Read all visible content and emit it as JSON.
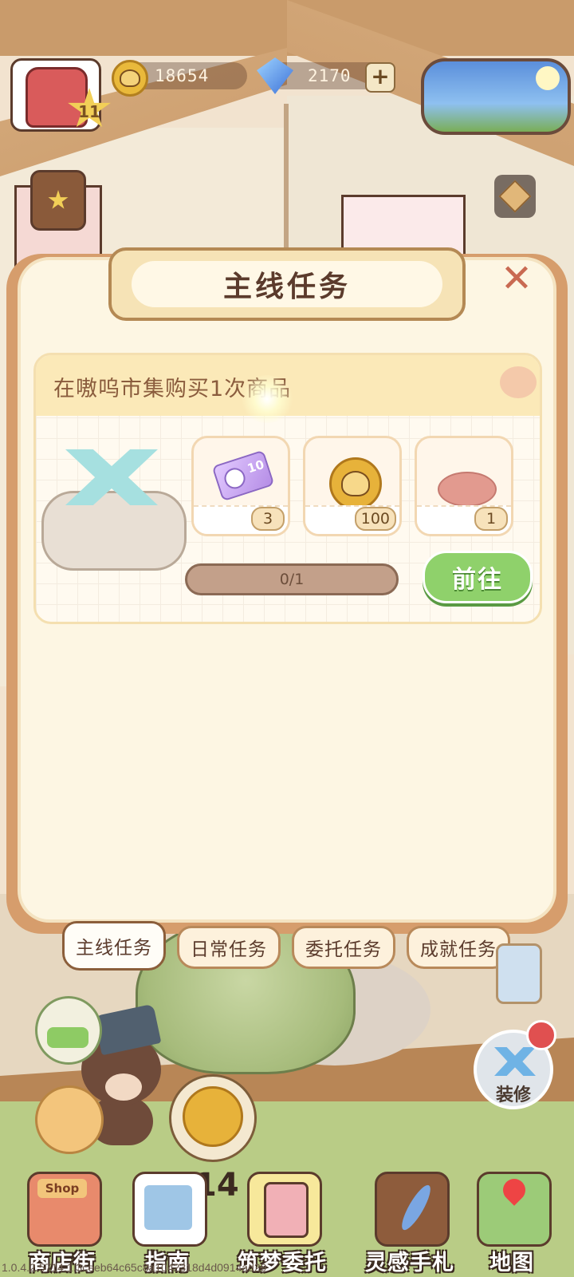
{
  "top_bar": {
    "level": "11",
    "coins": "18654",
    "gems": "2170",
    "plus_label": "+"
  },
  "dialog": {
    "title": "主线任务",
    "close_label": "✕",
    "task": {
      "description": "在嗷呜市集购买1次商品",
      "rewards": [
        {
          "icon": "time-ticket-icon",
          "icon_text": "10",
          "count": "3"
        },
        {
          "icon": "dog-coin-icon",
          "count": "100"
        },
        {
          "icon": "pink-cushion-icon",
          "count": "1"
        }
      ],
      "progress_text": "0/1",
      "progress_fraction": 0,
      "go_button": "前往"
    },
    "tabs": [
      {
        "label": "主线任务",
        "active": true
      },
      {
        "label": "日常任务",
        "active": false
      },
      {
        "label": "委托任务",
        "active": false
      },
      {
        "label": "成就任务",
        "active": false
      }
    ]
  },
  "side": {
    "decorate_label": "装修"
  },
  "center": {
    "number": "14"
  },
  "bottom_nav": [
    {
      "label": "商店街",
      "icon": "shop-icon",
      "sign": "Shop"
    },
    {
      "label": "指南",
      "icon": "guide-icon"
    },
    {
      "label": "筑梦委托",
      "icon": "commission-icon"
    },
    {
      "label": "灵感手札",
      "icon": "journal-icon"
    },
    {
      "label": "地图",
      "icon": "map-icon"
    }
  ],
  "version_text": "1.0.4.2.5714.1.3ceeb64c65c8a1042318d4d0914ad29",
  "colors": {
    "dialog_bg": "#fdf6e3",
    "title_brown": "#5b3b2c",
    "go_green": "#8fd16b",
    "close_red": "#c96a52"
  }
}
